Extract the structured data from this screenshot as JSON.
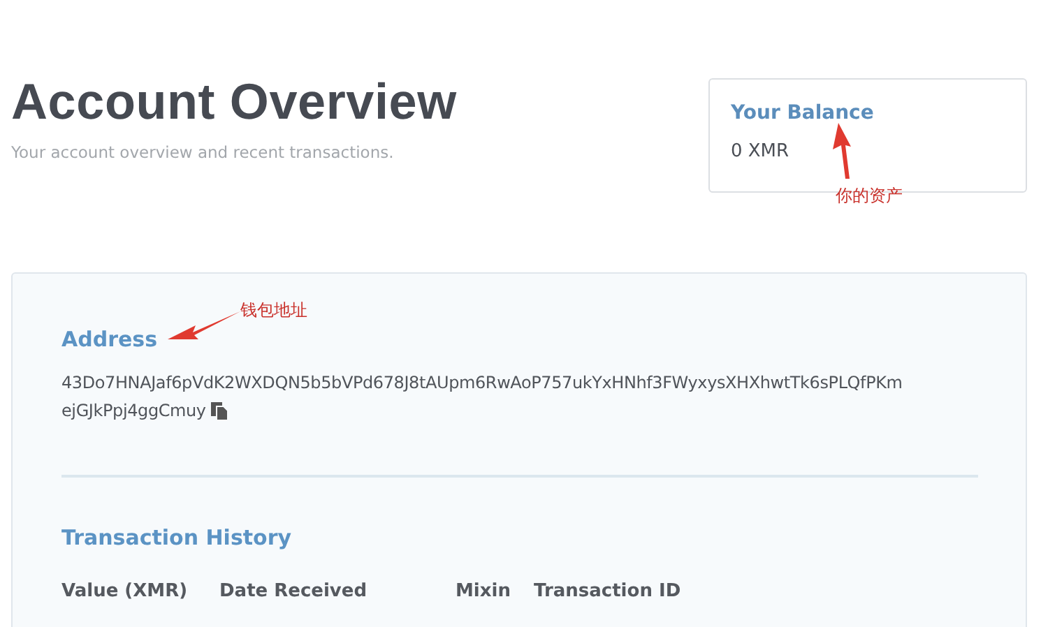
{
  "header": {
    "title": "Account Overview",
    "subtitle": "Your account overview and recent transactions."
  },
  "balance": {
    "heading": "Your Balance",
    "value": "0 XMR"
  },
  "address": {
    "heading": "Address",
    "lines": [
      "43Do7HNAJaf6pVdK2WXDQN5b5bVPd678J8tAUpm6RwAoP757ukYxHNhf3FWyxysXHXhwtTk6sPLQfPKm",
      "ejGJkPpj4ggCmuy"
    ]
  },
  "transactions": {
    "heading": "Transaction History",
    "columns": [
      "Value (XMR)",
      "Date Received",
      "Mixin",
      "Transaction ID"
    ]
  },
  "annotations": [
    {
      "kind": "address",
      "text": "钱包地址"
    },
    {
      "kind": "balance",
      "text": "你的资产"
    }
  ]
}
